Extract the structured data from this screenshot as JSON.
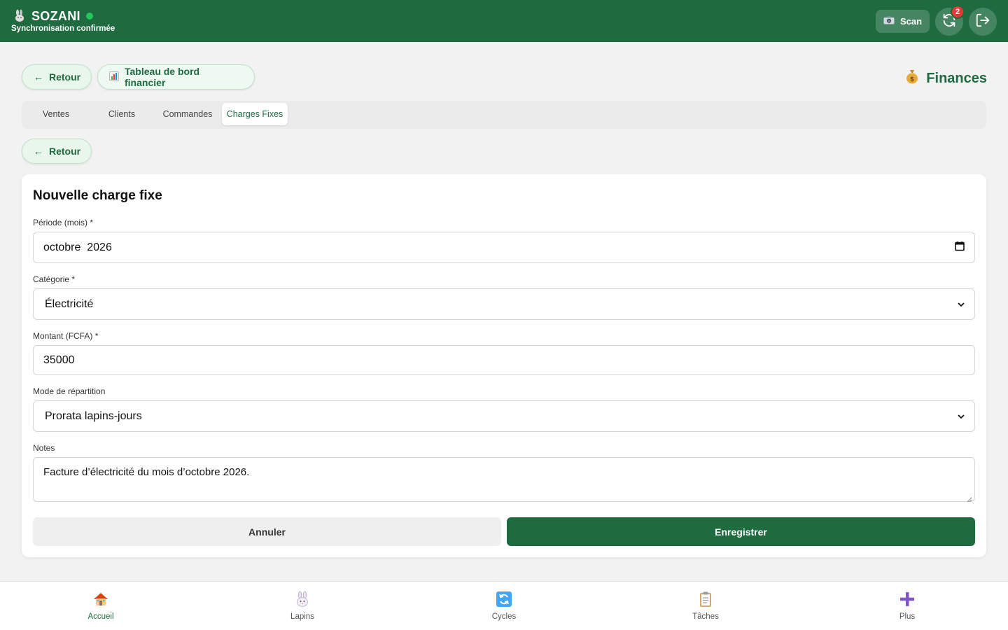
{
  "header": {
    "app_name": "SOZANI",
    "logo_icon": "rabbit-icon",
    "sync_status": "Synchronisation confirmée",
    "status_color": "#22c55e",
    "scan_label": "Scan",
    "sync_badge": "2",
    "brand_color": "#1e6b40"
  },
  "actions": {
    "back_label": "Retour",
    "dashboard_label": "Tableau de bord financier",
    "page_title": "Finances"
  },
  "tabs": [
    {
      "label": "Ventes",
      "active": false
    },
    {
      "label": "Clients",
      "active": false
    },
    {
      "label": "Commandes",
      "active": false
    },
    {
      "label": "Charges Fixes",
      "active": true
    }
  ],
  "secondary_back_label": "Retour",
  "form": {
    "title": "Nouvelle charge fixe",
    "periode": {
      "label": "Période (mois) *",
      "value": "octobre  2026"
    },
    "categorie": {
      "label": "Catégorie *",
      "value": "Électricité"
    },
    "montant": {
      "label": "Montant (FCFA) *",
      "value": "35000"
    },
    "repartition": {
      "label": "Mode de répartition",
      "value": "Prorata lapins-jours"
    },
    "notes": {
      "label": "Notes",
      "value": "Facture d’électricité du mois d’octobre 2026."
    },
    "cancel_label": "Annuler",
    "save_label": "Enregistrer"
  },
  "bottom_nav": [
    {
      "label": "Accueil",
      "icon": "house-icon",
      "active": true
    },
    {
      "label": "Lapins",
      "icon": "rabbit-icon",
      "active": false
    },
    {
      "label": "Cycles",
      "icon": "cycle-icon",
      "active": false
    },
    {
      "label": "Tâches",
      "icon": "clipboard-icon",
      "active": false
    },
    {
      "label": "Plus",
      "icon": "plus-icon",
      "active": false
    }
  ]
}
